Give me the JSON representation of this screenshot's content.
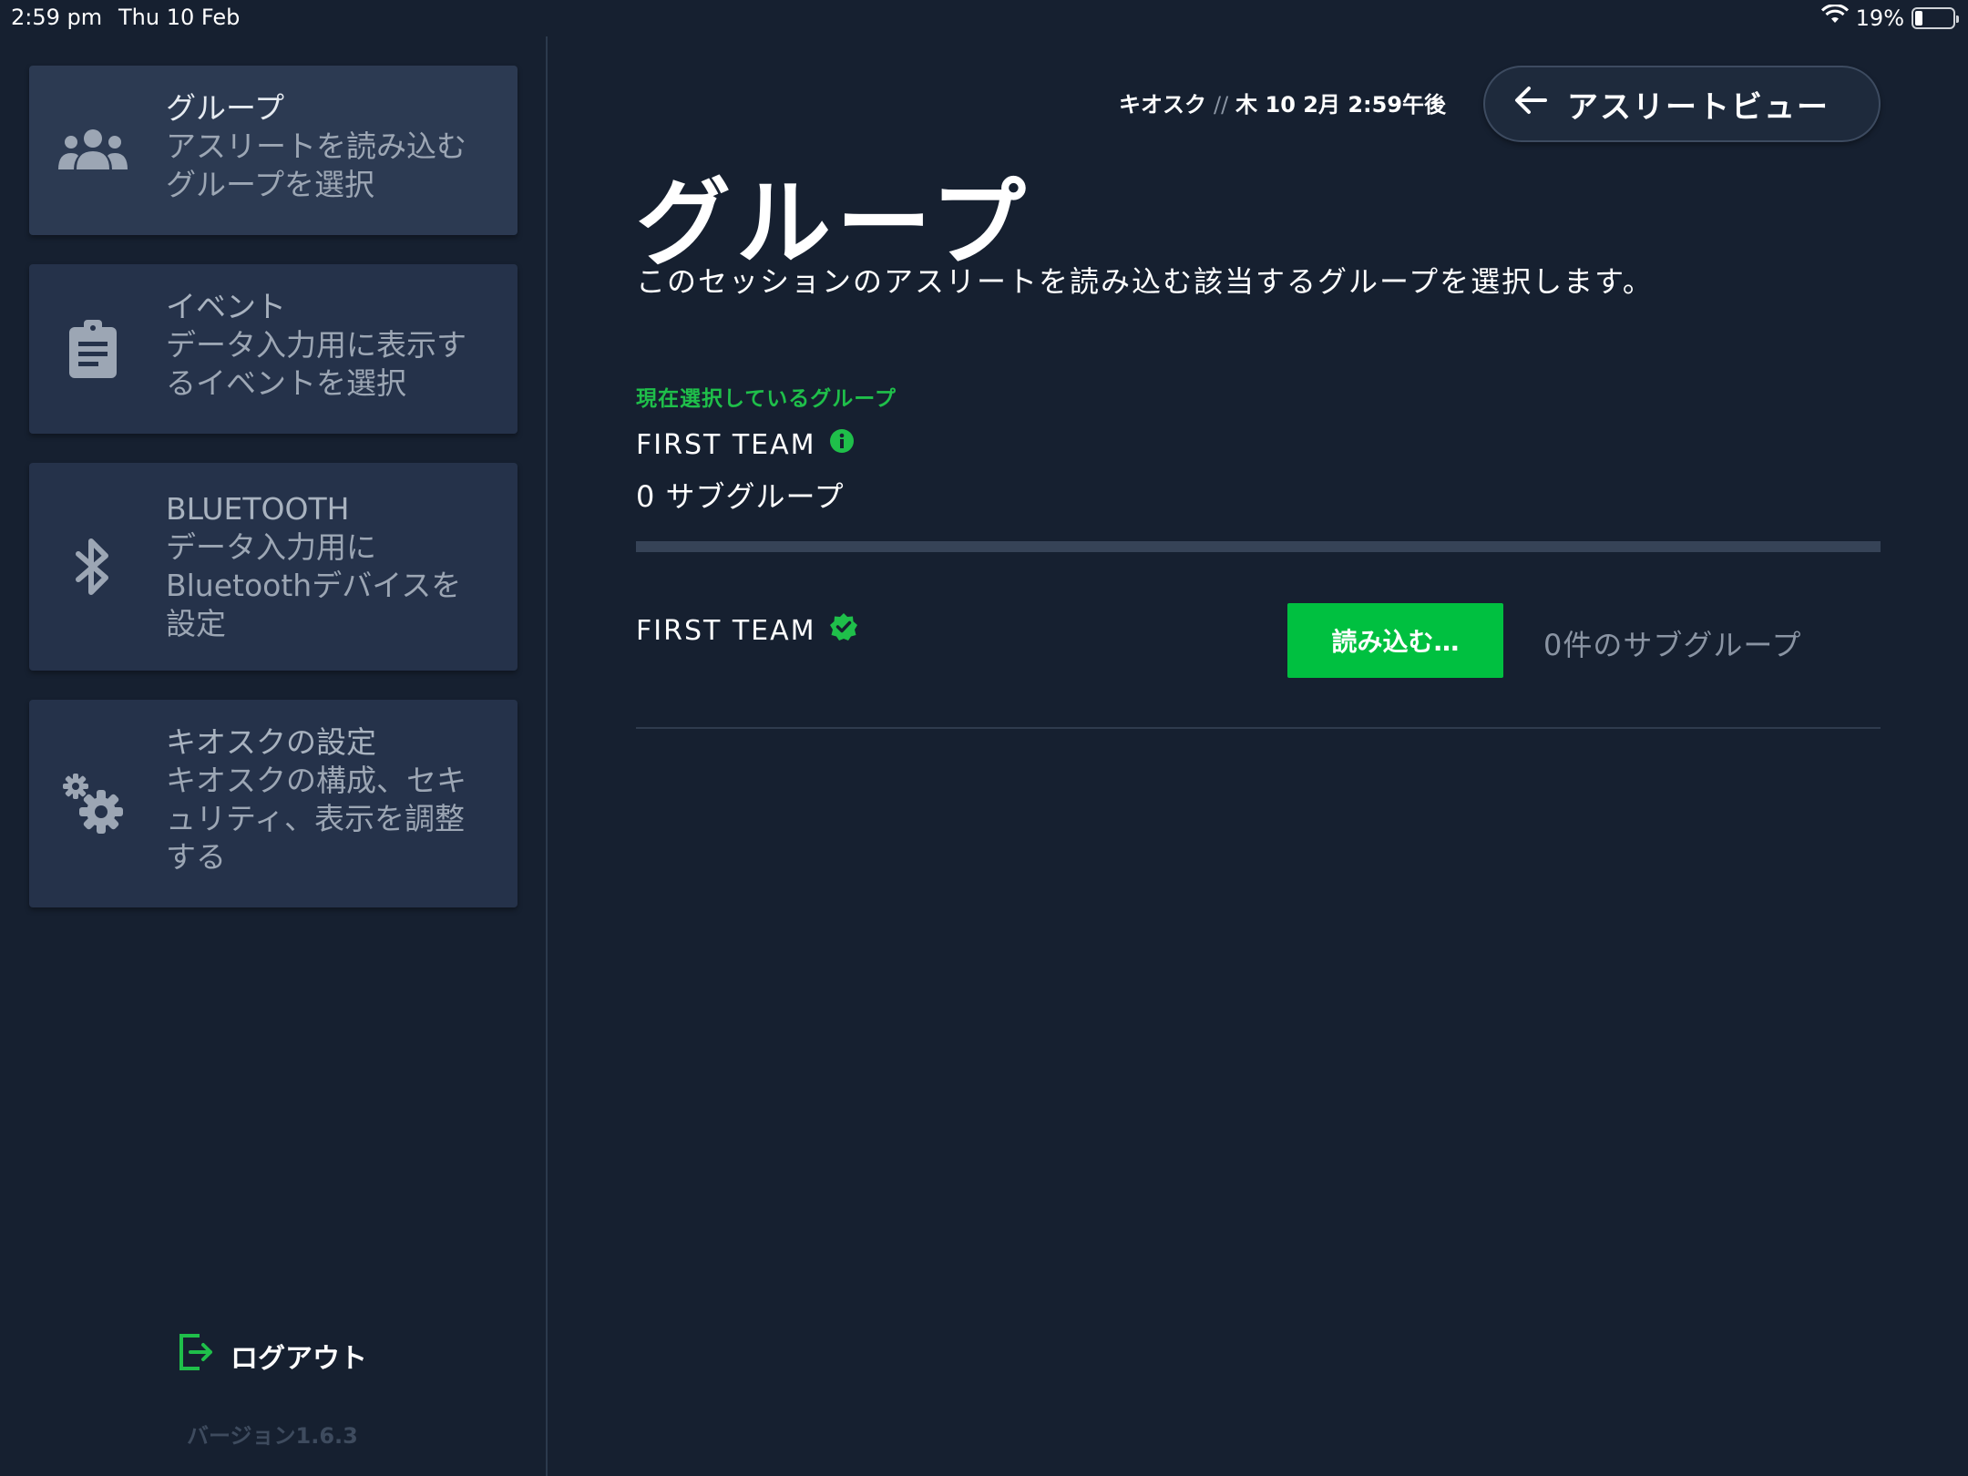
{
  "status_bar": {
    "time": "2:59 pm",
    "date": "Thu 10 Feb",
    "battery": "19%",
    "battery_level": 0.19
  },
  "sidebar": {
    "items": [
      {
        "title": "グループ",
        "desc": "アスリートを読み込むグループを選択",
        "icon": "group-icon"
      },
      {
        "title": "イベント",
        "desc": "データ入力用に表示するイベントを選択",
        "icon": "clipboard-icon"
      },
      {
        "title": "BLUETOOTH",
        "desc": "データ入力用にBluetoothデバイスを設定",
        "icon": "bluetooth-icon"
      },
      {
        "title": "キオスクの設定",
        "desc": "キオスクの構成、セキュリティ、表示を調整する",
        "icon": "gears-icon"
      }
    ],
    "logout_label": "ログアウト",
    "version": "バージョン1.6.3"
  },
  "header": {
    "kiosk": "キオスク",
    "separator": "//",
    "datetime": "木 10 2月 2:59午後",
    "athlete_view_label": "アスリートビュー"
  },
  "main": {
    "title": "グループ",
    "subtitle": "このセッションのアスリートを読み込む該当するグループを選択します。",
    "current_label": "現在選択しているグループ",
    "current_group": "FIRST TEAM",
    "current_subgroups": "0 サブグループ",
    "rows": [
      {
        "name": "FIRST TEAM",
        "load_label": "読み込む…",
        "subgroups": "0件のサブグループ"
      }
    ]
  },
  "colors": {
    "background": "#162030",
    "card": "#25324a",
    "accent_green": "#00c040"
  }
}
